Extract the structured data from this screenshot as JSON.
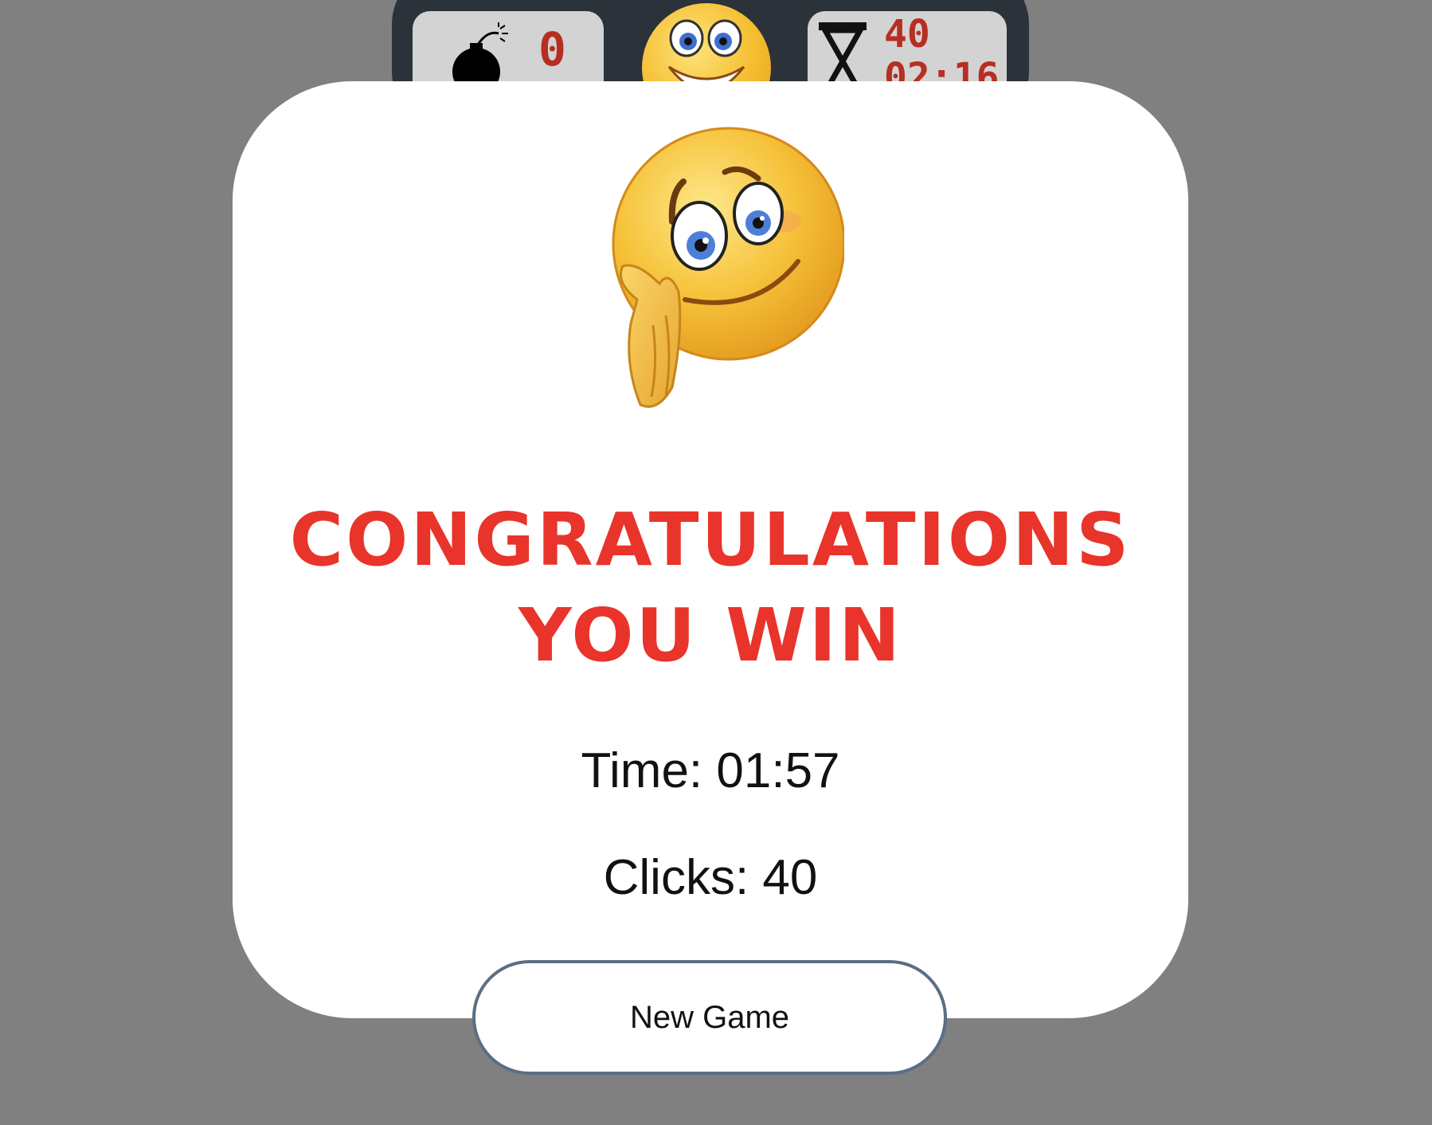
{
  "header": {
    "mine_counter": "0",
    "click_counter": "40",
    "timer": "02:16",
    "face_icon": "smiley-face-icon",
    "bomb_icon": "bomb-icon",
    "hourglass_icon": "hourglass-icon"
  },
  "modal": {
    "icon": "smiley-blowing-kiss-icon",
    "title_line1": "CONGRATULATIONS",
    "title_line2": "YOU WIN",
    "time_text": "Time: 01:57",
    "clicks_text": "Clicks: 40",
    "new_game_label": "New Game"
  },
  "colors": {
    "overlay": "#808080",
    "header_bg": "#2b323a",
    "counter_text": "#b72e22",
    "title": "#e8342a",
    "button_border": "#5a6e84"
  }
}
